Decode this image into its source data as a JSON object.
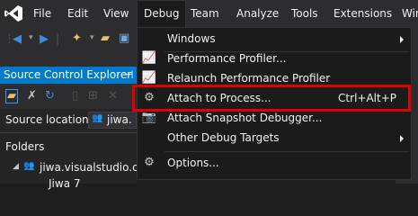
{
  "menubar": {
    "items": [
      "File",
      "Edit",
      "View",
      "Debug",
      "Team",
      "Analyze",
      "Tools",
      "Extensions",
      "Win"
    ]
  },
  "panel": {
    "title": "Source Control Explorer",
    "pin_glyph": "⊣",
    "source_location_label": "Source location:",
    "source_location_value": "jiwa.",
    "folders_label": "Folders",
    "tree_root": "jiwa.visualstudio.co",
    "tree_child": "Jiwa 7"
  },
  "debug_menu": {
    "items": [
      {
        "label": "Windows",
        "shortcut": "",
        "submenu": true,
        "icon": ""
      },
      {
        "label": "Performance Profiler...",
        "shortcut": "",
        "submenu": false,
        "icon": "performance-profiler-icon"
      },
      {
        "label": "Relaunch Performance Profiler",
        "shortcut": "",
        "submenu": false,
        "icon": "relaunch-profiler-icon"
      },
      {
        "label": "Attach to Process...",
        "shortcut": "Ctrl+Alt+P",
        "submenu": false,
        "icon": "attach-process-icon"
      },
      {
        "label": "Attach Snapshot Debugger...",
        "shortcut": "",
        "submenu": false,
        "icon": "snapshot-debugger-icon"
      },
      {
        "label": "Other Debug Targets",
        "shortcut": "",
        "submenu": true,
        "icon": ""
      },
      {
        "label": "Options...",
        "shortcut": "",
        "submenu": false,
        "icon": "gear-icon"
      }
    ]
  },
  "colors": {
    "accent": "#007acc",
    "highlight": "#e00000",
    "menu_bg": "#1b1b1c"
  }
}
